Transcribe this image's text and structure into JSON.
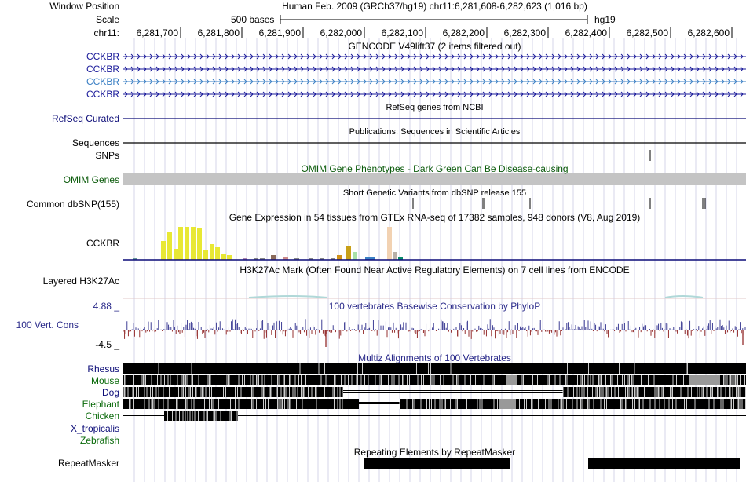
{
  "header": {
    "window_position_label": "Window Position",
    "window_position_text": "Human Feb. 2009 (GRCh37/hg19)   chr11:6,281,608-6,282,623 (1,016 bp)",
    "scale_label": "Scale",
    "scale_text": "500 bases",
    "assembly": "hg19",
    "chrom_label": "chr11:",
    "ruler_ticks": [
      "6,281,700",
      "6,281,800",
      "6,281,900",
      "6,282,000",
      "6,282,100",
      "6,282,200",
      "6,282,300",
      "6,282,400",
      "6,282,500",
      "6,282,600"
    ]
  },
  "tracks": {
    "gencode": {
      "title": "GENCODE V49lift37 (2 items filtered out)",
      "items": [
        {
          "label": "CCKBR",
          "color": "#1a1a9a"
        },
        {
          "label": "CCKBR",
          "color": "#1a1a9a"
        },
        {
          "label": "CCKBR",
          "color": "#3a7fc4"
        },
        {
          "label": "CCKBR",
          "color": "#1a1a9a"
        }
      ]
    },
    "refseq": {
      "title": "RefSeq genes from NCBI",
      "label": "RefSeq Curated",
      "color": "#0c0c78"
    },
    "publications": {
      "title": "Publications: Sequences in Scientific Articles",
      "label": "Sequences"
    },
    "snps": {
      "label": "SNPs"
    },
    "omim": {
      "title": "OMIM Gene Phenotypes - Dark Green Can Be Disease-causing",
      "label": "OMIM Genes",
      "color": "#0a5a0a"
    },
    "dbsnp": {
      "title": "Short Genetic Variants from dbSNP release 155",
      "label": "Common dbSNP(155)"
    },
    "gtex": {
      "title": "Gene Expression in 54 tissues from GTEx RNA-seq of 17382 samples, 948 donors (V8, Aug 2019)",
      "label": "CCKBR"
    },
    "h3k27ac": {
      "title": "H3K27Ac Mark (Often Found Near Active Regulatory Elements) on 7 cell lines from ENCODE",
      "label": "Layered H3K27Ac"
    },
    "conservation": {
      "title": "100 vertebrates Basewise Conservation by PhyloP",
      "label": "100 Vert. Cons",
      "max_label": "4.88 _",
      "min_label": "-4.5 _",
      "color": "#2a2a8a"
    },
    "multiz": {
      "title": "Multiz Alignments of 100 Vertebrates",
      "species": [
        {
          "label": "Rhesus",
          "color": "#0c0c78"
        },
        {
          "label": "Mouse",
          "color": "#0a6a0a"
        },
        {
          "label": "Dog",
          "color": "#0c0c78"
        },
        {
          "label": "Elephant",
          "color": "#0a6a0a"
        },
        {
          "label": "Chicken",
          "color": "#0a6a0a"
        },
        {
          "label": "X_tropicalis",
          "color": "#0c0c78"
        },
        {
          "label": "Zebrafish",
          "color": "#0a6a0a"
        }
      ]
    },
    "repeatmasker": {
      "title": "Repeating Elements by RepeatMasker",
      "label": "RepeatMasker"
    }
  }
}
